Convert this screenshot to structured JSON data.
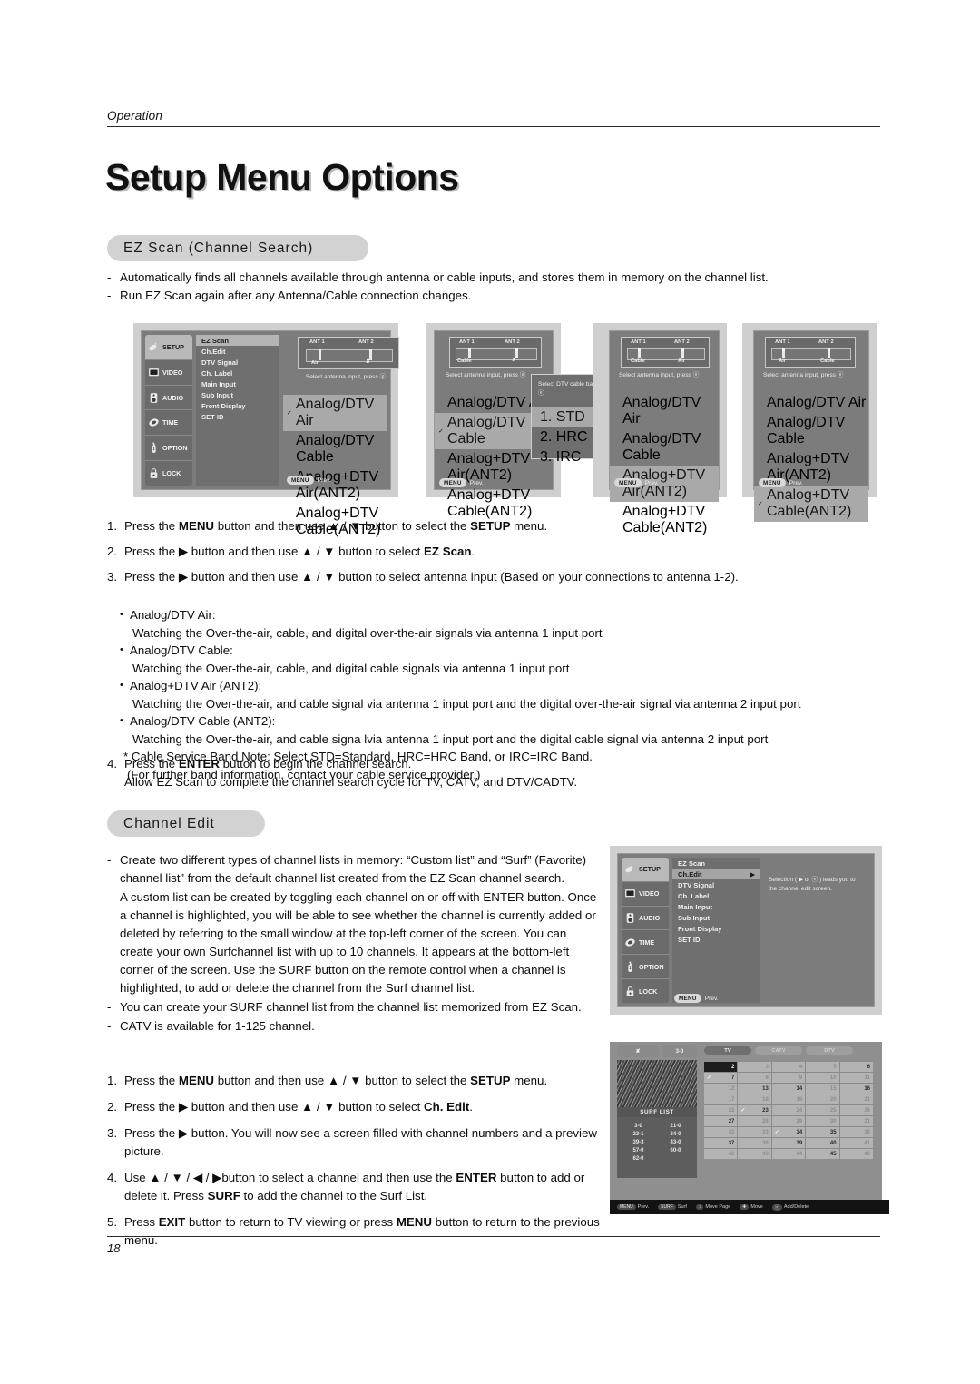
{
  "header": {
    "section_label": "Operation",
    "page_title": "Setup Menu Options",
    "page_number": "18"
  },
  "sections": {
    "ez_scan": {
      "heading": "EZ Scan (Channel Search)"
    },
    "channel_edit": {
      "heading": "Channel Edit"
    }
  },
  "ez_intro": [
    "Automatically finds all channels available through antenna or cable inputs, and stores them in memory on the channel list.",
    "Run EZ Scan again after any Antenna/Cable connection changes."
  ],
  "ez_steps": [
    {
      "num": "1.",
      "parts": [
        {
          "t": "Press the ",
          "b": false
        },
        {
          "t": "MENU",
          "b": true
        },
        {
          "t": " button and then use ",
          "b": false
        },
        {
          "t": "▲",
          "b": false
        },
        {
          "t": " / ",
          "b": false
        },
        {
          "t": "▼",
          "b": false
        },
        {
          "t": " button to select the ",
          "b": false
        },
        {
          "t": "SETUP",
          "b": true
        },
        {
          "t": " menu.",
          "b": false
        }
      ]
    },
    {
      "num": "2.",
      "parts": [
        {
          "t": "Press the ",
          "b": false
        },
        {
          "t": "▶",
          "b": false
        },
        {
          "t": " button and then use ",
          "b": false
        },
        {
          "t": "▲",
          "b": false
        },
        {
          "t": " / ",
          "b": false
        },
        {
          "t": "▼",
          "b": false
        },
        {
          "t": " button to select ",
          "b": false
        },
        {
          "t": "EZ Scan",
          "b": true
        },
        {
          "t": ".",
          "b": false
        }
      ]
    },
    {
      "num": "3.",
      "parts": [
        {
          "t": "Press the ",
          "b": false
        },
        {
          "t": "▶",
          "b": false
        },
        {
          "t": " button and then use ",
          "b": false
        },
        {
          "t": "▲",
          "b": false
        },
        {
          "t": " / ",
          "b": false
        },
        {
          "t": "▼",
          "b": false
        },
        {
          "t": " button to select antenna input (Based on your connections to antenna 1-2).",
          "b": false
        }
      ]
    }
  ],
  "ez_inputs": [
    {
      "label": "Analog/DTV Air:",
      "desc": "Watching the Over-the-air, cable, and digital over-the-air signals via antenna 1 input port"
    },
    {
      "label": "Analog/DTV Cable:",
      "desc": "Watching the Over-the-air, cable, and digital cable signals via antenna 1 input port"
    },
    {
      "label": "Analog+DTV Air (ANT2):",
      "desc": "Watching the Over-the-air, and cable signal via antenna 1 input port and the digital over-the-air signal via antenna 2 input port"
    },
    {
      "label": "Analog/DTV Cable (ANT2):",
      "desc": "Watching the Over-the-air, and cable signa lvia antenna 1 input port and the digital cable signal via antenna 2 input port"
    }
  ],
  "ez_note": [
    "* Cable Service Band Note: Select STD=Standard, HRC=HRC Band, or IRC=IRC Band.",
    "(For further band information, contact your cable service provider.)"
  ],
  "ez_step4": {
    "num": "4.",
    "parts": [
      {
        "t": "Press the ",
        "b": false
      },
      {
        "t": "ENTER",
        "b": true
      },
      {
        "t": " button to begin the channel search.",
        "b": false
      }
    ],
    "sub": "Allow EZ Scan to complete the channel search cycle for TV, CATV, and DTV/CADTV."
  },
  "ce_bullets": [
    "Create two different types of channel lists in memory: “Custom list” and “Surf” (Favorite) channel list” from the default channel list created from the EZ Scan channel search.",
    "A custom list can be created by toggling each channel on or off with ENTER button. Once a channel is highlighted, you will be able to see whether the channel is currently added or deleted by referring to the small window at the top-left corner of the screen. You can create your own Surfchannel list with up to 10 channels. It appears at the bottom-left corner of the screen. Use the SURF button on the remote control when a channel is highlighted, to add or delete the channel from the Surf channel list.",
    "You can create your SURF channel list from the channel list memorized from EZ Scan.",
    "CATV is available for 1-125 channel."
  ],
  "ce_steps": [
    {
      "num": "1.",
      "parts": [
        {
          "t": "Press the ",
          "b": false
        },
        {
          "t": "MENU",
          "b": true
        },
        {
          "t": " button and then use ",
          "b": false
        },
        {
          "t": "▲ / ▼",
          "b": false
        },
        {
          "t": " button to select the ",
          "b": false
        },
        {
          "t": "SETUP",
          "b": true
        },
        {
          "t": " menu.",
          "b": false
        }
      ]
    },
    {
      "num": "2.",
      "parts": [
        {
          "t": "Press the ",
          "b": false
        },
        {
          "t": "▶",
          "b": false
        },
        {
          "t": " button and then use ",
          "b": false
        },
        {
          "t": "▲ / ▼",
          "b": false
        },
        {
          "t": " button to select ",
          "b": false
        },
        {
          "t": "Ch. Edit",
          "b": true
        },
        {
          "t": ".",
          "b": false
        }
      ]
    },
    {
      "num": "3.",
      "parts": [
        {
          "t": "Press the ",
          "b": false
        },
        {
          "t": "▶",
          "b": false
        },
        {
          "t": " button. You will now see a screen filled with channel numbers and a preview picture.",
          "b": false
        }
      ]
    },
    {
      "num": "4.",
      "parts": [
        {
          "t": "Use ",
          "b": false
        },
        {
          "t": "▲ / ▼ / ◀ / ▶",
          "b": false
        },
        {
          "t": "button to select a channel and then use the ",
          "b": false
        },
        {
          "t": "ENTER",
          "b": true
        },
        {
          "t": " button to add or delete it. Press ",
          "b": false
        },
        {
          "t": "SURF",
          "b": true
        },
        {
          "t": " to add the channel to the Surf List.",
          "b": false
        }
      ]
    },
    {
      "num": "5.",
      "parts": [
        {
          "t": "Press ",
          "b": false
        },
        {
          "t": "EXIT",
          "b": true
        },
        {
          "t": " button to return to TV viewing or press ",
          "b": false
        },
        {
          "t": "MENU",
          "b": true
        },
        {
          "t": " button to return to the previous menu.",
          "b": false
        }
      ]
    }
  ],
  "osd": {
    "sidebar": [
      {
        "label": "SETUP",
        "icon": "satellite-dish-icon"
      },
      {
        "label": "VIDEO",
        "icon": "monitor-icon"
      },
      {
        "label": "AUDIO",
        "icon": "speaker-icon"
      },
      {
        "label": "TIME",
        "icon": "clock-icon"
      },
      {
        "label": "OPTION",
        "icon": "remote-icon"
      },
      {
        "label": "LOCK",
        "icon": "padlock-icon"
      }
    ],
    "menu_items": [
      "EZ Scan",
      "Ch.Edit",
      "DTV Signal",
      "Ch. Label",
      "Main Input",
      "Sub Input",
      "Front Display",
      "SET ID"
    ],
    "menu_button": {
      "key": "MENU",
      "action": "Prev."
    },
    "antenna_labels": {
      "ant1": "ANT 1",
      "ant2": "ANT 2"
    },
    "help_antenna": "Select antenna input, press ⓔ",
    "help_band": "Select DTV cable band, press ⓔ",
    "input_options": [
      "Analog/DTV Air",
      "Analog/DTV Cable",
      "Analog+DTV Air(ANT2)",
      "Analog+DTV Cable(ANT2)"
    ],
    "band_options": [
      "1. STD",
      "2. HRC",
      "3. IRC"
    ],
    "check_glyph": "✓",
    "panels": [
      {
        "ant1": "Air",
        "ant2": "✘",
        "selected": 0
      },
      {
        "ant1": "Cable",
        "ant2": "✘",
        "selected": 1
      },
      {
        "ant1": "Cable",
        "ant2": "Air",
        "selected": 2
      },
      {
        "ant1": "Air",
        "ant2": "Cable",
        "selected": 3
      }
    ],
    "ch_edit_panel": {
      "selected_item": "Ch.Edit",
      "arrow_glyph": "▶",
      "help": "Selection ( ▶ or ⓔ ) leads you to the channel edit screen."
    }
  },
  "ch_edit_screen": {
    "badge_left": "✘",
    "badge_right": "3-0",
    "surf_title": "SURF LIST",
    "surf_channels": [
      "3-0",
      "21-0",
      "23-1",
      "34-0",
      "39-3",
      "43-0",
      "57-0",
      "60-0",
      "62-0"
    ],
    "tabs": [
      "TV",
      "CATV",
      "DTV"
    ],
    "current_channel": "2",
    "grid": [
      {
        "n": "2",
        "on": true,
        "cur": true
      },
      {
        "n": "3",
        "on": false
      },
      {
        "n": "4",
        "on": false
      },
      {
        "n": "5",
        "on": false
      },
      {
        "n": "6",
        "on": true
      },
      {
        "n": "7",
        "on": true,
        "mark": true
      },
      {
        "n": "8",
        "on": false
      },
      {
        "n": "9",
        "on": false
      },
      {
        "n": "10",
        "on": false
      },
      {
        "n": "11",
        "on": false
      },
      {
        "n": "12",
        "on": false
      },
      {
        "n": "13",
        "on": true
      },
      {
        "n": "14",
        "on": true
      },
      {
        "n": "15",
        "on": false
      },
      {
        "n": "16",
        "on": true
      },
      {
        "n": "17",
        "on": false
      },
      {
        "n": "18",
        "on": false
      },
      {
        "n": "19",
        "on": false
      },
      {
        "n": "20",
        "on": false
      },
      {
        "n": "21",
        "on": false
      },
      {
        "n": "22",
        "on": false
      },
      {
        "n": "23",
        "on": true,
        "mark": true
      },
      {
        "n": "24",
        "on": false
      },
      {
        "n": "25",
        "on": false
      },
      {
        "n": "26",
        "on": false
      },
      {
        "n": "27",
        "on": true
      },
      {
        "n": "28",
        "on": false
      },
      {
        "n": "29",
        "on": false
      },
      {
        "n": "30",
        "on": false
      },
      {
        "n": "31",
        "on": false
      },
      {
        "n": "32",
        "on": false
      },
      {
        "n": "33",
        "on": false
      },
      {
        "n": "34",
        "on": true,
        "mark": true
      },
      {
        "n": "35",
        "on": true
      },
      {
        "n": "36",
        "on": false
      },
      {
        "n": "37",
        "on": true
      },
      {
        "n": "38",
        "on": false
      },
      {
        "n": "39",
        "on": true
      },
      {
        "n": "40",
        "on": true
      },
      {
        "n": "41",
        "on": false
      },
      {
        "n": "42",
        "on": false
      },
      {
        "n": "43",
        "on": false
      },
      {
        "n": "44",
        "on": false
      },
      {
        "n": "45",
        "on": true
      },
      {
        "n": "46",
        "on": false
      }
    ],
    "bottom_bar": [
      {
        "key": "MENU",
        "label": "Prev."
      },
      {
        "key": "SURF",
        "label": "Surf"
      },
      {
        "key": "↕",
        "label": "Move Page"
      },
      {
        "key": "✚",
        "label": "Move"
      },
      {
        "key": "ⓔ",
        "label": "Add/Delete"
      }
    ]
  }
}
